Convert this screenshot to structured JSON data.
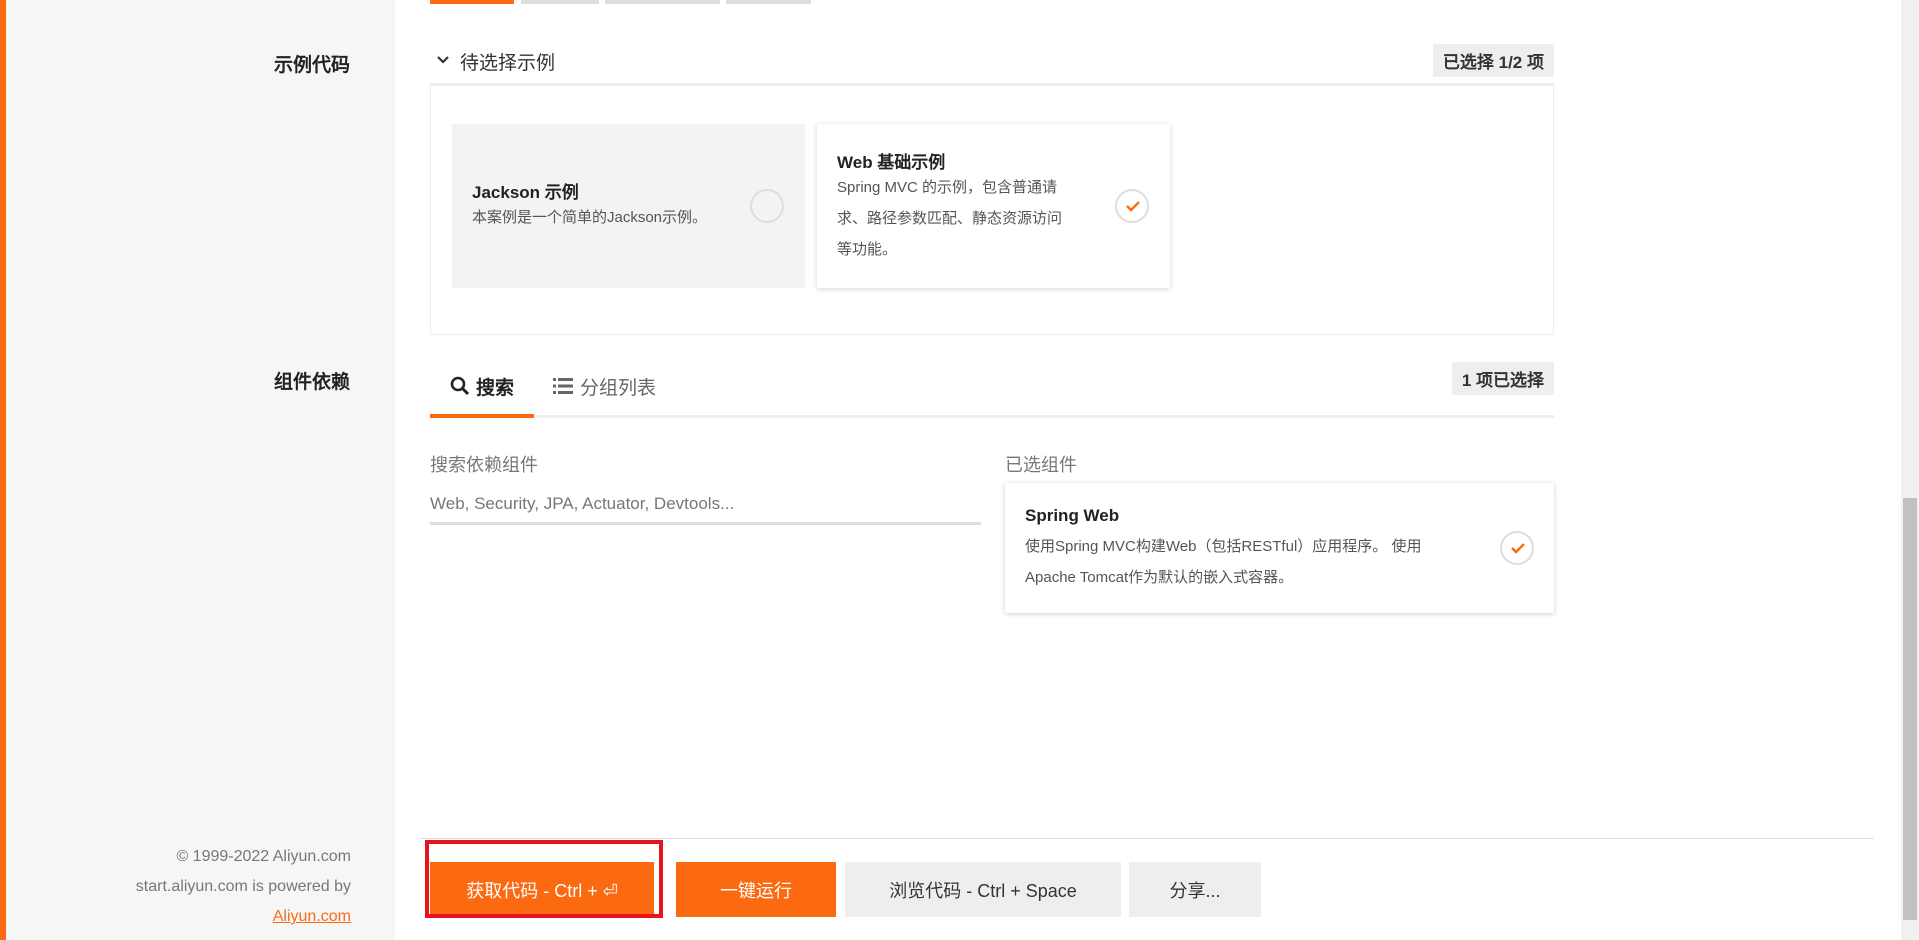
{
  "sections": {
    "example_code_label": "示例代码",
    "dependencies_label": "组件依赖"
  },
  "examples": {
    "header_title": "待选择示例",
    "selected_badge": "已选择 1/2 项",
    "cards": [
      {
        "title": "Jackson 示例",
        "desc_lines": [
          "本案例是一个简单的Jackson示例。"
        ],
        "selected": false
      },
      {
        "title": "Web 基础示例",
        "desc_lines": [
          "Spring MVC 的示例，包含普通请",
          "求、路径参数匹配、静态资源访问",
          "等功能。"
        ],
        "selected": true
      }
    ]
  },
  "dependencies": {
    "tabs": [
      {
        "label": "搜索",
        "icon": "search-icon",
        "active": true
      },
      {
        "label": "分组列表",
        "icon": "list-icon",
        "active": false
      }
    ],
    "selected_badge": "1 项已选择",
    "search_label": "搜索依赖组件",
    "search_placeholder": "Web, Security, JPA, Actuator, Devtools...",
    "selected_label": "已选组件",
    "selected_items": [
      {
        "title": "Spring Web",
        "desc_lines": [
          "使用Spring MVC构建Web（包括RESTful）应用程序。 使用",
          "Apache Tomcat作为默认的嵌入式容器。"
        ],
        "selected": true
      }
    ]
  },
  "footer": {
    "copyright": "© 1999-2022 Aliyun.com",
    "powered_by": "start.aliyun.com is powered by",
    "link": "Aliyun.com"
  },
  "actions": {
    "get_code": "获取代码 - Ctrl + ⏎",
    "run": "一键运行",
    "browse": "浏览代码 - Ctrl + Space",
    "share": "分享..."
  },
  "colors": {
    "accent": "#fb6a10",
    "highlight": "#e8141c"
  }
}
